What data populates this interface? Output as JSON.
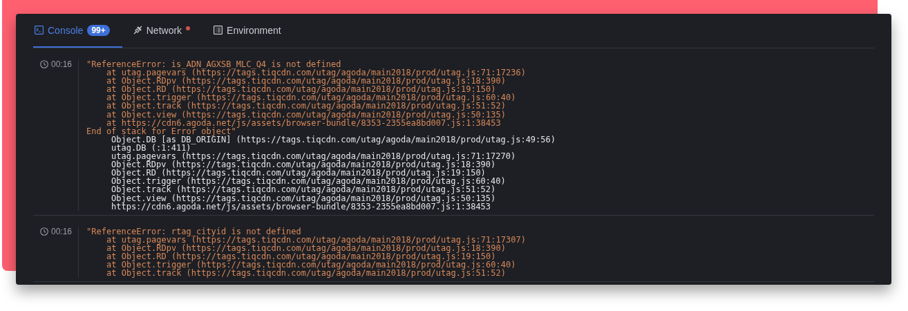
{
  "tabs": [
    {
      "kind": "console",
      "label": "Console",
      "badge": "99+",
      "selected": true,
      "alert": false
    },
    {
      "kind": "network",
      "label": "Network",
      "selected": false,
      "alert": true
    },
    {
      "kind": "environment",
      "label": "Environment",
      "selected": false,
      "alert": false
    }
  ],
  "entries": [
    {
      "time": "00:16",
      "lines": [
        {
          "kind": "message",
          "text": "\"ReferenceError: is_ADN_AGXSB_MLC_Q4 is not defined"
        },
        {
          "kind": "frame",
          "text": "at utag.pagevars (https://tags.tiqcdn.com/utag/agoda/main2018/prod/utag.js:71:17236)"
        },
        {
          "kind": "frame",
          "text": "at Object.RDpv (https://tags.tiqcdn.com/utag/agoda/main2018/prod/utag.js:18:390)"
        },
        {
          "kind": "frame",
          "text": "at Object.RD (https://tags.tiqcdn.com/utag/agoda/main2018/prod/utag.js:19:150)"
        },
        {
          "kind": "frame",
          "text": "at Object.trigger (https://tags.tiqcdn.com/utag/agoda/main2018/prod/utag.js:60:40)"
        },
        {
          "kind": "frame",
          "text": "at Object.track (https://tags.tiqcdn.com/utag/agoda/main2018/prod/utag.js:51:52)"
        },
        {
          "kind": "frame",
          "text": "at Object.view (https://tags.tiqcdn.com/utag/agoda/main2018/prod/utag.js:50:135)"
        },
        {
          "kind": "frame",
          "text": "at https://cdn6.agoda.net/js/assets/browser-bundle/8353-2355ea8bd007.js:1:38453"
        },
        {
          "kind": "message",
          "text": "End of stack for Error object\""
        },
        {
          "kind": "trace",
          "text": "Object.DB [as DB_ORIGIN] (https://tags.tiqcdn.com/utag/agoda/main2018/prod/utag.js:49:56)"
        },
        {
          "kind": "trace",
          "text": "utag.DB (:1:411)"
        },
        {
          "kind": "trace",
          "text": "utag.pagevars (https://tags.tiqcdn.com/utag/agoda/main2018/prod/utag.js:71:17270)"
        },
        {
          "kind": "trace",
          "text": "Object.RDpv (https://tags.tiqcdn.com/utag/agoda/main2018/prod/utag.js:18:390)"
        },
        {
          "kind": "trace",
          "text": "Object.RD (https://tags.tiqcdn.com/utag/agoda/main2018/prod/utag.js:19:150)"
        },
        {
          "kind": "trace",
          "text": "Object.trigger (https://tags.tiqcdn.com/utag/agoda/main2018/prod/utag.js:60:40)"
        },
        {
          "kind": "trace",
          "text": "Object.track (https://tags.tiqcdn.com/utag/agoda/main2018/prod/utag.js:51:52)"
        },
        {
          "kind": "trace",
          "text": "Object.view (https://tags.tiqcdn.com/utag/agoda/main2018/prod/utag.js:50:135)"
        },
        {
          "kind": "trace",
          "text": "https://cdn6.agoda.net/js/assets/browser-bundle/8353-2355ea8bd007.js:1:38453"
        }
      ]
    },
    {
      "time": "00:16",
      "lines": [
        {
          "kind": "message",
          "text": "\"ReferenceError: rtag_cityid is not defined"
        },
        {
          "kind": "frame",
          "text": "at utag.pagevars (https://tags.tiqcdn.com/utag/agoda/main2018/prod/utag.js:71:17307)"
        },
        {
          "kind": "frame",
          "text": "at Object.RDpv (https://tags.tiqcdn.com/utag/agoda/main2018/prod/utag.js:18:390)"
        },
        {
          "kind": "frame",
          "text": "at Object.RD (https://tags.tiqcdn.com/utag/agoda/main2018/prod/utag.js:19:150)"
        },
        {
          "kind": "frame",
          "text": "at Object.trigger (https://tags.tiqcdn.com/utag/agoda/main2018/prod/utag.js:60:40)"
        },
        {
          "kind": "frame",
          "text": "at Object.track (https://tags.tiqcdn.com/utag/agoda/main2018/prod/utag.js:51:52)"
        }
      ]
    }
  ]
}
